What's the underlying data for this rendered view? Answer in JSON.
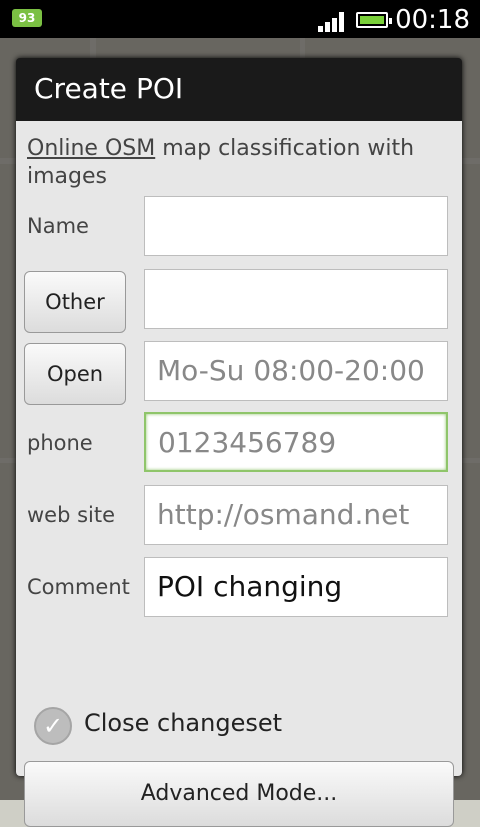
{
  "status_bar": {
    "notification_badge": "93",
    "time": "00:18"
  },
  "dialog": {
    "title": "Create POI",
    "classification": {
      "link": "Online OSM",
      "text": " map classification with images"
    },
    "name_label": "Name",
    "name_value": "",
    "type_button": "Other",
    "type_value": "",
    "hours_button": "Open",
    "hours_placeholder": "Mo-Su 08:00-20:00",
    "phone_label": "phone",
    "phone_placeholder": "0123456789",
    "website_label": "web site",
    "website_placeholder": "http://osmand.net",
    "comment_label": "Comment",
    "comment_value": "POI changing",
    "close_changeset_label": "Close changeset",
    "close_changeset_checked": true,
    "advanced_button": "Advanced Mode..."
  }
}
